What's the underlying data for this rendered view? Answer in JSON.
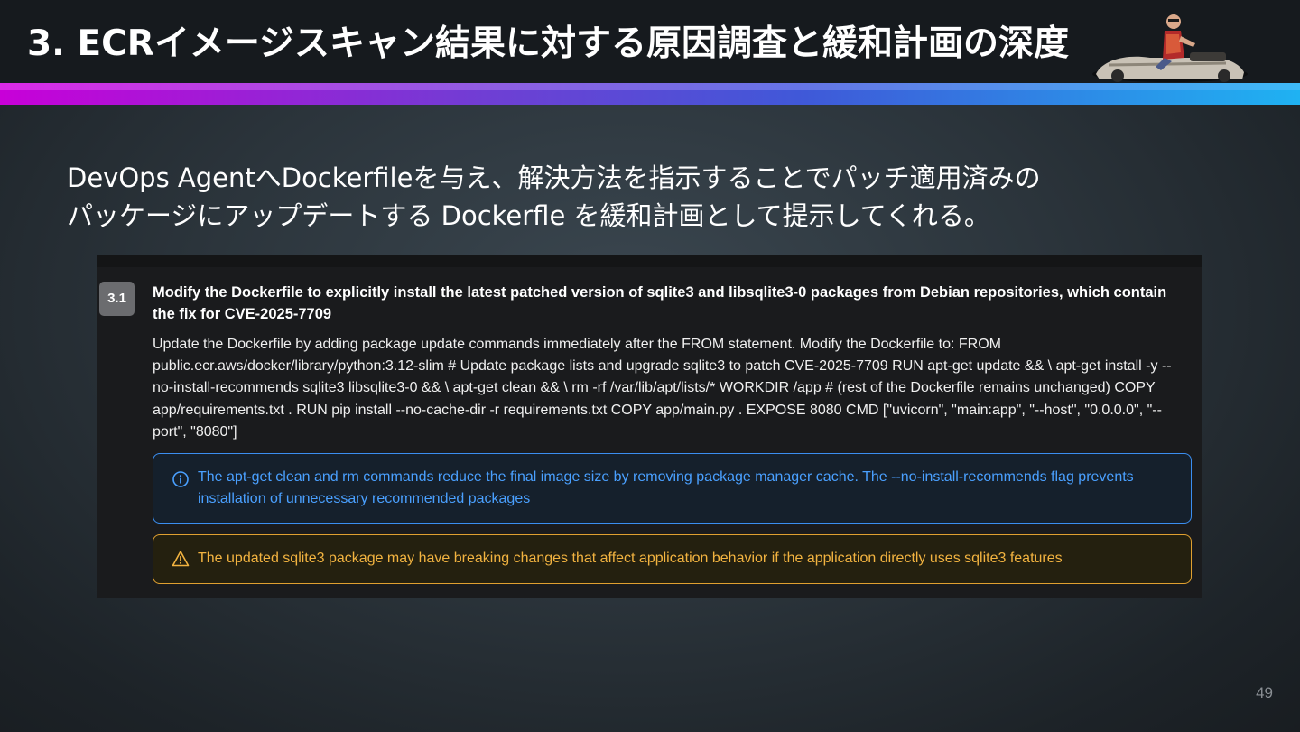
{
  "slide": {
    "title": "3. ECRイメージスキャン結果に対する原因調査と緩和計画の深度",
    "subtitle_line1": "DevOps AgentへDockerfileを与え、解決方法を指示することでパッチ適用済みの",
    "subtitle_line2": "パッケージにアップデートする Dockerfle を緩和計画として提示してくれる。",
    "page_number": "49"
  },
  "step": {
    "number": "3.1",
    "title": "Modify the Dockerfile to explicitly install the latest patched version of sqlite3 and libsqlite3-0 packages from Debian repositories, which contain the fix for CVE-2025-7709",
    "body": "Update the Dockerfile by adding package update commands immediately after the FROM statement. Modify the Dockerfile to: FROM public.ecr.aws/docker/library/python:3.12-slim # Update package lists and upgrade sqlite3 to patch CVE-2025-7709 RUN apt-get update && \\ apt-get install -y --no-install-recommends sqlite3 libsqlite3-0 && \\ apt-get clean && \\ rm -rf /var/lib/apt/lists/* WORKDIR /app # (rest of the Dockerfile remains unchanged) COPY app/requirements.txt . RUN pip install --no-cache-dir -r requirements.txt COPY app/main.py . EXPOSE 8080 CMD [\"uvicorn\", \"main:app\", \"--host\", \"0.0.0.0\", \"--port\", \"8080\"]",
    "info": {
      "icon": "info-circle-icon",
      "text": "The apt-get clean and rm commands reduce the final image size by removing package manager cache. The --no-install-recommends flag prevents installation of unnecessary recommended packages"
    },
    "warning": {
      "icon": "warning-triangle-icon",
      "text": "The updated sqlite3 package may have breaking changes that affect application behavior if the application directly uses sqlite3 features"
    }
  },
  "colors": {
    "info_accent": "#3b8ef0",
    "warning_accent": "#e0a030",
    "gradient_start": "#c800d8",
    "gradient_end": "#1fb2f2"
  }
}
